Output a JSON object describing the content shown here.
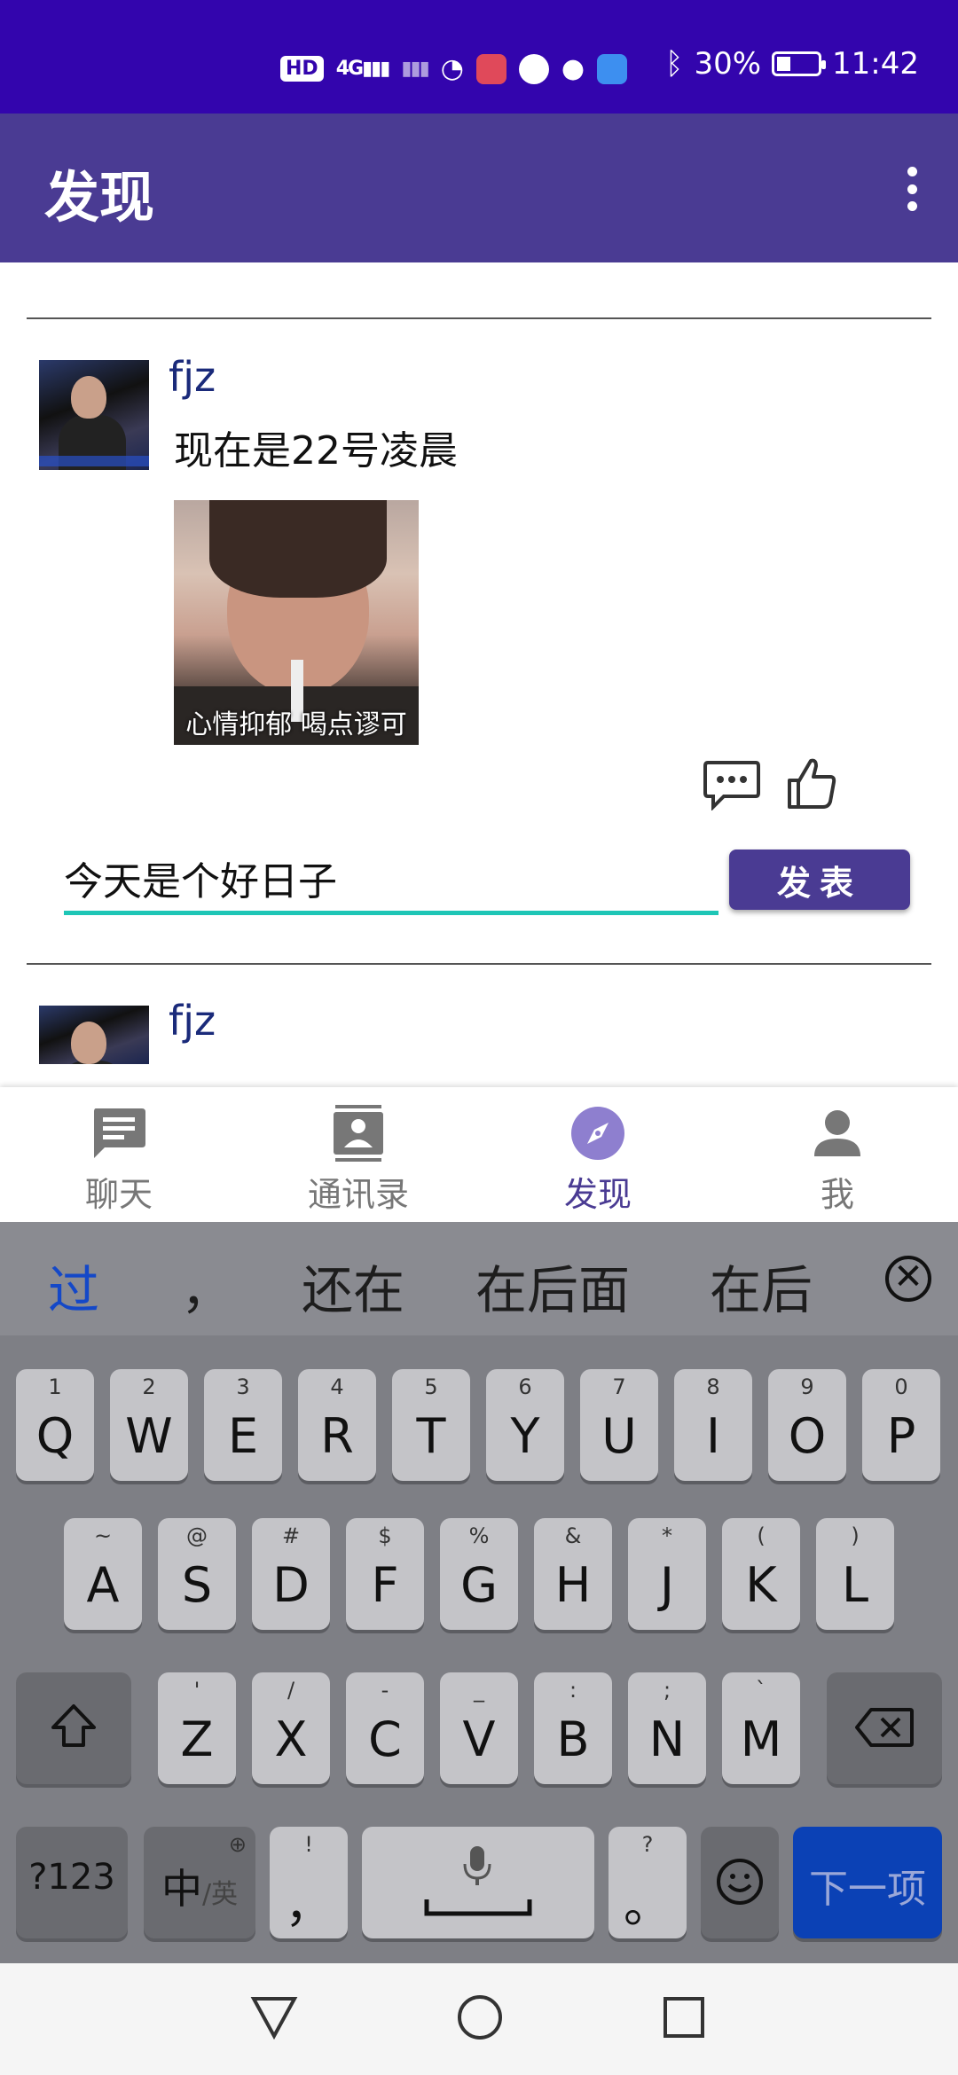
{
  "status_bar": {
    "left_icons": [
      "hd-icon",
      "signal-4g-icon",
      "signal-icon",
      "wifi-icon",
      "huawei-app-icon",
      "message-app-icon",
      "chat-bubble-icon",
      "app-icon"
    ],
    "hd": "HD",
    "signal_text": "4G",
    "battery": "30%",
    "time": "11:42"
  },
  "app_bar": {
    "title": "发现"
  },
  "posts": [
    {
      "author": "fjz",
      "text": "现在是22号凌晨",
      "image_caption": "心情抑郁 喝点谬可"
    },
    {
      "author": "fjz"
    }
  ],
  "comment": {
    "value": "今天是个好日子",
    "publish": "发表"
  },
  "bottom_nav": {
    "items": [
      {
        "label": "聊天",
        "icon": "chat-icon"
      },
      {
        "label": "通讯录",
        "icon": "contacts-icon"
      },
      {
        "label": "发现",
        "icon": "compass-icon",
        "active": true
      },
      {
        "label": "我",
        "icon": "person-icon"
      }
    ]
  },
  "keyboard": {
    "candidates": [
      "过",
      "，",
      "还在",
      "在后面",
      "在后"
    ],
    "row1": [
      {
        "k": "Q",
        "h": "1"
      },
      {
        "k": "W",
        "h": "2"
      },
      {
        "k": "E",
        "h": "3"
      },
      {
        "k": "R",
        "h": "4"
      },
      {
        "k": "T",
        "h": "5"
      },
      {
        "k": "Y",
        "h": "6"
      },
      {
        "k": "U",
        "h": "7"
      },
      {
        "k": "I",
        "h": "8"
      },
      {
        "k": "O",
        "h": "9"
      },
      {
        "k": "P",
        "h": "0"
      }
    ],
    "row2": [
      {
        "k": "A",
        "h": "~"
      },
      {
        "k": "S",
        "h": "@"
      },
      {
        "k": "D",
        "h": "#"
      },
      {
        "k": "F",
        "h": "$"
      },
      {
        "k": "G",
        "h": "%"
      },
      {
        "k": "H",
        "h": "&"
      },
      {
        "k": "J",
        "h": "*"
      },
      {
        "k": "K",
        "h": "("
      },
      {
        "k": "L",
        "h": ")"
      }
    ],
    "row3": [
      {
        "k": "Z",
        "h": "'"
      },
      {
        "k": "X",
        "h": "/"
      },
      {
        "k": "C",
        "h": "-"
      },
      {
        "k": "V",
        "h": "_"
      },
      {
        "k": "B",
        "h": ":"
      },
      {
        "k": "N",
        "h": ";"
      },
      {
        "k": "M",
        "h": "`"
      }
    ],
    "sym": "?123",
    "lang_main": "中",
    "lang_sub": "/英",
    "comma_hint": "!",
    "comma": "，",
    "period_hint": "?",
    "period": "。",
    "next": "下一项"
  },
  "colors": {
    "status_bar": "#3305ad",
    "app_bar": "#4a3b93",
    "accent": "#1ec6b6",
    "keyboard": "#7e7f85"
  }
}
